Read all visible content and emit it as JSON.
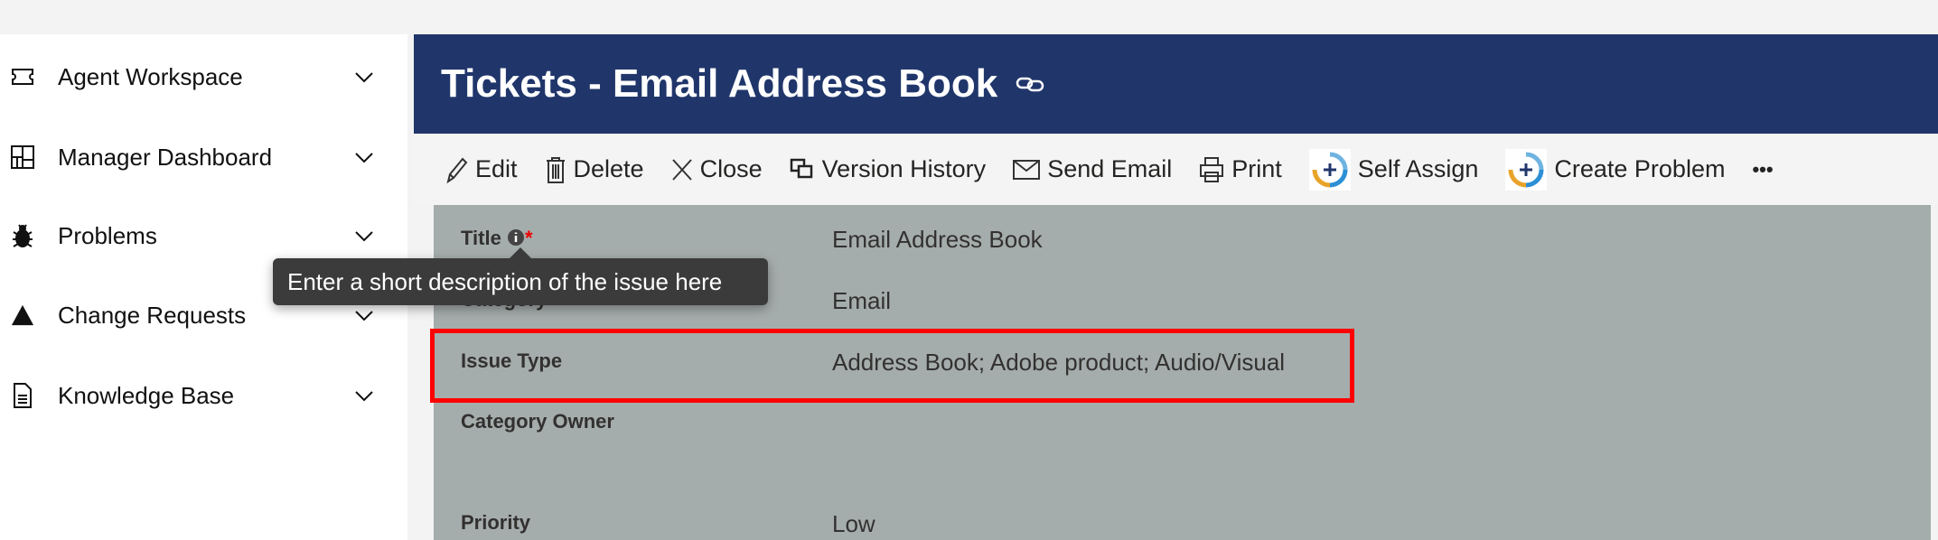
{
  "sidebar": {
    "items": [
      {
        "label": "Agent Workspace",
        "icon": "ticket-icon"
      },
      {
        "label": "Manager Dashboard",
        "icon": "dashboard-icon"
      },
      {
        "label": "Problems",
        "icon": "bug-icon"
      },
      {
        "label": "Change Requests",
        "icon": "triangle-icon"
      },
      {
        "label": "Knowledge Base",
        "icon": "document-icon"
      }
    ]
  },
  "header": {
    "title": "Tickets - Email Address Book",
    "icon": "link-icon",
    "color": "#20366b"
  },
  "toolbar": {
    "edit": "Edit",
    "delete": "Delete",
    "close": "Close",
    "version_history": "Version History",
    "send_email": "Send Email",
    "print": "Print",
    "self_assign": "Self Assign",
    "create_problem": "Create Problem",
    "more": "•••"
  },
  "form": {
    "title": {
      "label": "Title",
      "required": "*",
      "value": "Email Address Book"
    },
    "category": {
      "label": "Category",
      "required": "*",
      "value": "Email"
    },
    "issue_type": {
      "label": "Issue Type",
      "value": "Address Book; Adobe product; Audio/Visual"
    },
    "category_owner": {
      "label": "Category Owner",
      "value": ""
    },
    "priority": {
      "label": "Priority",
      "value": "Low"
    }
  },
  "tooltip": {
    "text": "Enter a short description of the issue here"
  },
  "highlight_color": "#ff0000"
}
